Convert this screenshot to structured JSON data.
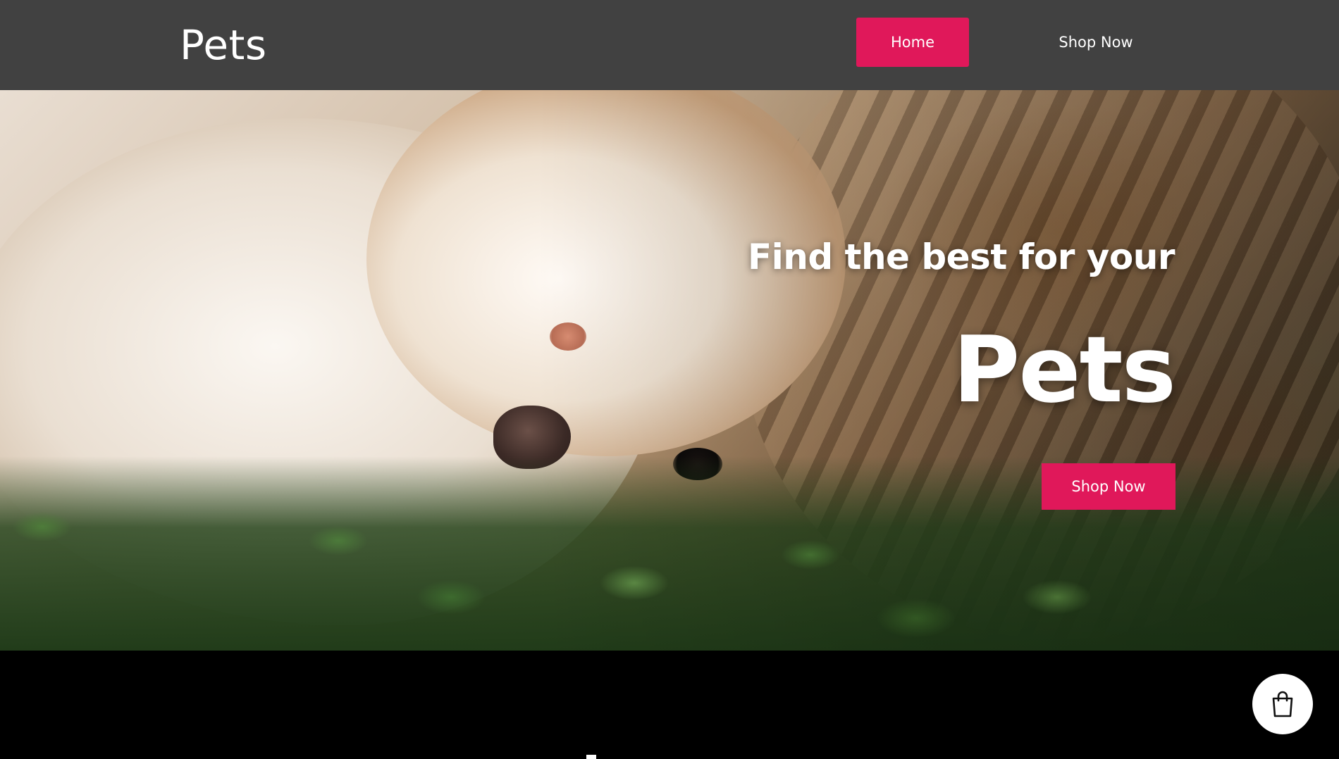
{
  "header": {
    "logo": "Pets",
    "nav": [
      {
        "label": "Home",
        "active": true
      },
      {
        "label": "Shop Now",
        "active": false
      }
    ]
  },
  "hero": {
    "tagline": "Find the best for your",
    "title": "Pets",
    "cta_label": "Shop Now"
  },
  "floating": {
    "cart_icon": "shopping-bag-icon"
  },
  "colors": {
    "header_bg": "#414141",
    "accent": "#e0185a",
    "bottom_bg": "#000000"
  }
}
